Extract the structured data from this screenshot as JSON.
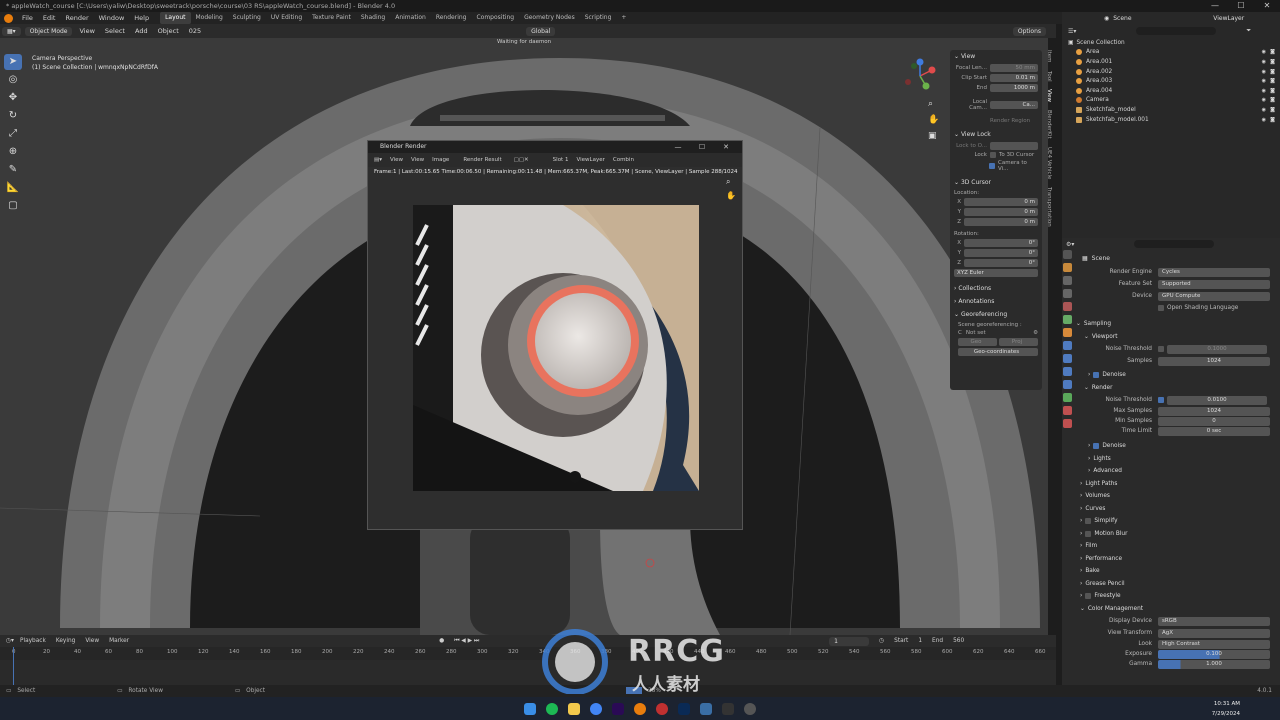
{
  "window": {
    "title": "* appleWatch_course [C:\\Users\\yaliw\\Desktop\\sweetrack\\porsche\\course\\03 RS\\appleWatch_course.blend] - Blender 4.0",
    "controls": [
      "—",
      "☐",
      "✕"
    ]
  },
  "menubar": {
    "menus": [
      "File",
      "Edit",
      "Render",
      "Window",
      "Help"
    ],
    "workspaces": [
      "Layout",
      "Modeling",
      "Sculpting",
      "UV Editing",
      "Texture Paint",
      "Shading",
      "Animation",
      "Rendering",
      "Compositing",
      "Geometry Nodes",
      "Scripting"
    ],
    "add_workspace": "+",
    "scene_label": "Scene",
    "viewlayer_label": "ViewLayer"
  },
  "viewport_header": {
    "mode": "Object Mode",
    "menus": [
      "View",
      "Select",
      "Add",
      "Object"
    ],
    "extra": "025",
    "transform": "Global",
    "options": "Options",
    "status": "Waiting for daemon"
  },
  "viewport": {
    "camera_title": "Camera Perspective",
    "collection_line": "(1) Scene Collection | wmnqxNpNCdRfDfA"
  },
  "npanel": {
    "tabs": [
      "Item",
      "Tool",
      "View",
      "BlenderKit",
      "UE4 Vehicle",
      "Transportation"
    ],
    "view_header": "View",
    "focal_label": "Focal Len...",
    "focal_value": "50 mm",
    "clip_start_label": "Clip Start",
    "clip_start_value": "0.01 m",
    "end_label": "End",
    "end_value": "1000 m",
    "local_camera_label": "Local Cam...",
    "local_camera_value": "Ca...",
    "render_region": "Render Region",
    "view_lock_header": "View Lock",
    "lock_object_label": "Lock to O...",
    "lock_label": "Lock",
    "to_3d_cursor": "To 3D Cursor",
    "camera_to_view": "Camera to Vi...",
    "cursor_header": "3D Cursor",
    "location_label": "Location:",
    "x_label": "X",
    "y_label": "Y",
    "z_label": "Z",
    "loc_x": "0 m",
    "loc_y": "0 m",
    "loc_z": "0 m",
    "rotation_label": "Rotation:",
    "rot_x": "0°",
    "rot_y": "0°",
    "rot_z": "0°",
    "rotation_mode": "XYZ Euler",
    "collections": "Collections",
    "annotations": "Annotations",
    "georeferencing": "Georeferencing",
    "scene_geo_label": "Scene georeferencing :",
    "not_set": "Not set",
    "geo_c": "C",
    "geo_btn_a": "Geo",
    "geo_btn_b": "Proj",
    "geo_coordinates": "Geo-coordinates"
  },
  "render_window": {
    "title": "Blender Render",
    "controls": [
      "—",
      "☐",
      "✕"
    ],
    "menus": [
      "View",
      "View",
      "Image"
    ],
    "slot_name": "Render Result",
    "slot": "Slot 1",
    "layer": "ViewLayer",
    "pass": "Combin",
    "stats": "Frame:1 | Last:00:15.65 Time:00:06.50 | Remaining:00:11.48 | Mem:665.37M, Peak:665.37M | Scene, ViewLayer | Sample 288/1024"
  },
  "outliner": {
    "root": "Scene Collection",
    "items": [
      {
        "name": "Area"
      },
      {
        "name": "Area.001"
      },
      {
        "name": "Area.002"
      },
      {
        "name": "Area.003"
      },
      {
        "name": "Area.004"
      },
      {
        "name": "Camera"
      },
      {
        "name": "Sketchfab_model"
      },
      {
        "name": "Sketchfab_model.001"
      }
    ]
  },
  "properties": {
    "header": "Scene",
    "render_engine_label": "Render Engine",
    "render_engine": "Cycles",
    "feature_set_label": "Feature Set",
    "feature_set": "Supported",
    "device_label": "Device",
    "device": "GPU Compute",
    "osl": "Open Shading Language",
    "sampling": "Sampling",
    "viewport_sub": "Viewport",
    "noise_threshold_label": "Noise Threshold",
    "vp_noise": "0.1000",
    "samples_label": "Samples",
    "vp_samples": "1024",
    "denoise": "Denoise",
    "render_sub": "Render",
    "r_noise": "0.0100",
    "max_samples_label": "Max Samples",
    "max_samples": "1024",
    "min_samples_label": "Min Samples",
    "min_samples": "0",
    "time_limit_label": "Time Limit",
    "time_limit": "0 sec",
    "lights": "Lights",
    "advanced": "Advanced",
    "sections": [
      "Light Paths",
      "Volumes",
      "Curves",
      "Simplify",
      "Motion Blur",
      "Film",
      "Performance",
      "Bake",
      "Grease Pencil",
      "Freestyle",
      "Color Management"
    ],
    "display_device_label": "Display Device",
    "display_device": "sRGB",
    "view_transform_label": "View Transform",
    "view_transform": "AgX",
    "look_label": "Look",
    "look": "High Contrast",
    "exposure_label": "Exposure",
    "exposure": "0.100",
    "gamma_label": "Gamma",
    "gamma": "1.000"
  },
  "timeline": {
    "menus": [
      "Playback",
      "Keying",
      "View",
      "Marker"
    ],
    "current_frame": "1",
    "start_label": "Start",
    "start": "1",
    "end_label": "End",
    "end": "560",
    "ticks": [
      "0",
      "20",
      "40",
      "60",
      "80",
      "100",
      "120",
      "140",
      "160",
      "180",
      "200",
      "220",
      "240",
      "260",
      "280",
      "300",
      "320",
      "340",
      "360",
      "380",
      "400",
      "420",
      "440",
      "460",
      "480",
      "500",
      "520",
      "540",
      "560",
      "580",
      "600",
      "620",
      "640",
      "660"
    ]
  },
  "statusbar": {
    "select": "Select",
    "rotate": "Rotate View",
    "object": "Object",
    "progress": "28%",
    "version": "4.0.1"
  },
  "taskbar": {
    "time": "10:31 AM",
    "date": "7/29/2024"
  },
  "watermark": {
    "brand": "RRCG",
    "sub": "人人素材"
  }
}
